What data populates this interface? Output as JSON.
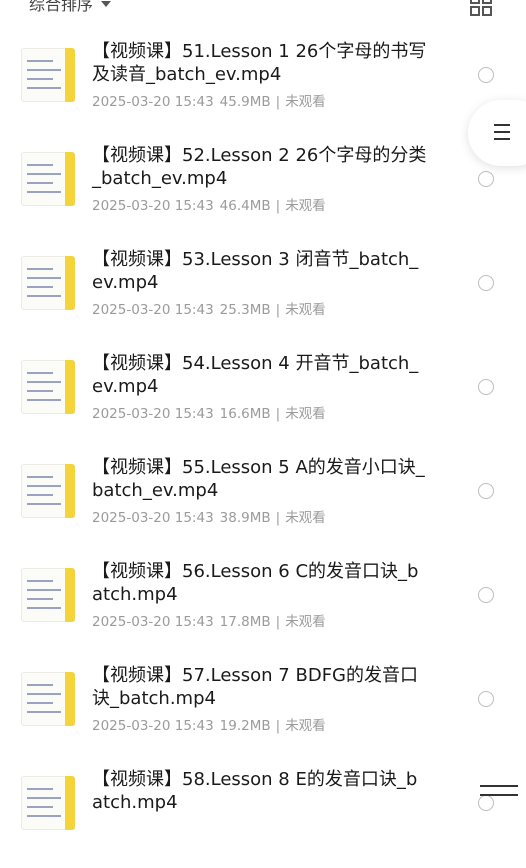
{
  "toolbar": {
    "sort_label": "综合排序",
    "sort_arrow_icon": "caret-down-icon",
    "view_toggle_icon": "grid-icon"
  },
  "floating_menu_icon": "menu-icon",
  "files": [
    {
      "title": "【视频课】51.Lesson 1 26个字母的书写及读音_batch_ev.mp4",
      "date": "2025-03-20 15:43",
      "size": "45.9MB",
      "status": "未观看"
    },
    {
      "title": "【视频课】52.Lesson 2 26个字母的分类_batch_ev.mp4",
      "date": "2025-03-20 15:43",
      "size": "46.4MB",
      "status": "未观看"
    },
    {
      "title": "【视频课】53.Lesson 3 闭音节_batch_ev.mp4",
      "date": "2025-03-20 15:43",
      "size": "25.3MB",
      "status": "未观看"
    },
    {
      "title": "【视频课】54.Lesson 4 开音节_batch_ev.mp4",
      "date": "2025-03-20 15:43",
      "size": "16.6MB",
      "status": "未观看"
    },
    {
      "title": "【视频课】55.Lesson 5 A的发音小口诀_batch_ev.mp4",
      "date": "2025-03-20 15:43",
      "size": "38.9MB",
      "status": "未观看"
    },
    {
      "title": "【视频课】56.Lesson 6 C的发音口诀_batch.mp4",
      "date": "2025-03-20 15:43",
      "size": "17.8MB",
      "status": "未观看"
    },
    {
      "title": "【视频课】57.Lesson 7 BDFG的发音口诀_batch.mp4",
      "date": "2025-03-20 15:43",
      "size": "19.2MB",
      "status": "未观看"
    },
    {
      "title": "【视频课】58.Lesson 8 E的发音口诀_batch.mp4",
      "date": "",
      "size": "",
      "status": ""
    }
  ],
  "meta_separator": "|"
}
